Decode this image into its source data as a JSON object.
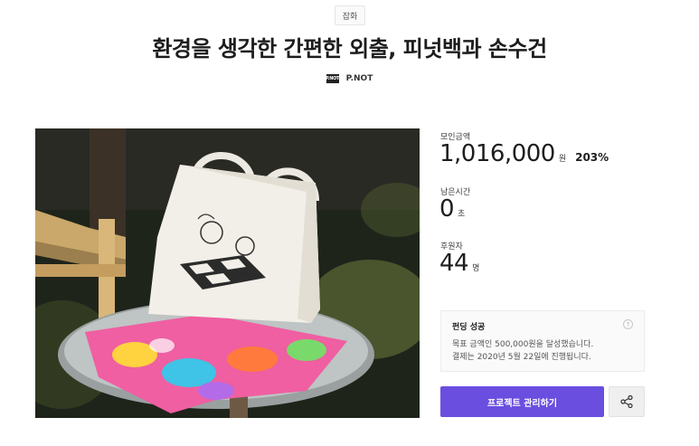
{
  "category": "잡화",
  "title": "환경을 생각한 간편한 외출, 피넛백과 손수건",
  "creator": {
    "logo_text": "P.NOT",
    "name": "P.NOT"
  },
  "stats": {
    "amount": {
      "label": "모인금액",
      "value": "1,016,000",
      "unit": "원",
      "percent": "203%"
    },
    "time_left": {
      "label": "남은시간",
      "value": "0",
      "unit": "초"
    },
    "backers": {
      "label": "후원자",
      "value": "44",
      "unit": "명"
    }
  },
  "funding_status": {
    "title": "펀딩 성공",
    "line1": "목표 금액인 500,000원을 달성했습니다.",
    "line2": "결제는 2020년 5월 22일에 진행됩니다.",
    "help_icon": "?"
  },
  "actions": {
    "manage_label": "프로젝트 관리하기",
    "share_icon": "share-icon"
  },
  "colors": {
    "primary": "#6a4ee0",
    "text": "#1d1d1d"
  }
}
